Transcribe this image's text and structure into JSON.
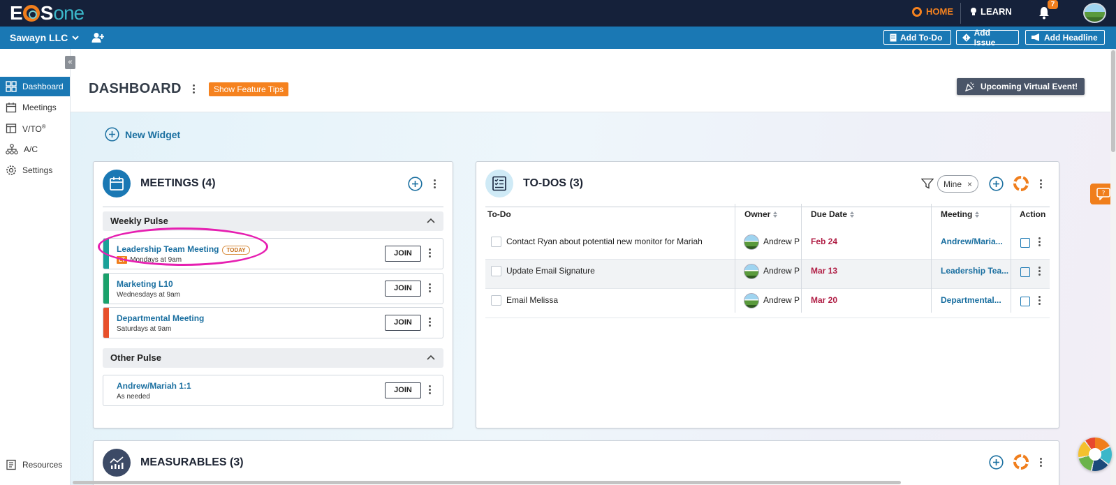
{
  "brand": {
    "logo_text_a": "E",
    "logo_text_s": "S",
    "logo_text_one": "one"
  },
  "topnav": {
    "home": "HOME",
    "learn": "LEARN",
    "notifications_count": "7"
  },
  "companybar": {
    "company": "Sawayn LLC",
    "add_todo": "Add To-Do",
    "add_issue": "Add Issue",
    "add_headline": "Add Headline"
  },
  "sidebar": {
    "items": [
      {
        "label": "Dashboard",
        "active": true
      },
      {
        "label": "Meetings"
      },
      {
        "label": "V/TO",
        "sup": "®"
      },
      {
        "label": "A/C"
      },
      {
        "label": "Settings"
      }
    ],
    "resources": "Resources"
  },
  "dashboard": {
    "title": "DASHBOARD",
    "feature_tips": "Show Feature Tips",
    "virtual_event": "Upcoming Virtual Event!",
    "new_widget": "New Widget"
  },
  "meetings": {
    "title": "MEETINGS (4)",
    "groups": [
      {
        "label": "Weekly Pulse"
      },
      {
        "label": "Other Pulse"
      }
    ],
    "items": [
      {
        "name": "Leadership Team Meeting",
        "badge": "TODAY",
        "tag": "LT",
        "time": "Mondays at 9am",
        "color": "#1aa199",
        "join": "JOIN"
      },
      {
        "name": "Marketing L10",
        "time": "Wednesdays at 9am",
        "color": "#1aa16b",
        "join": "JOIN"
      },
      {
        "name": "Departmental Meeting",
        "time": "Saturdays at 9am",
        "color": "#e8502b",
        "join": "JOIN"
      },
      {
        "name": "Andrew/Mariah 1:1",
        "time": "As needed",
        "color": "#ffffff",
        "join": "JOIN"
      }
    ]
  },
  "todos": {
    "title": "TO-DOS (3)",
    "filter_chip": "Mine",
    "columns": [
      "To-Do",
      "Owner",
      "Due Date",
      "Meeting",
      "Action"
    ],
    "rows": [
      {
        "todo": "Contact Ryan about potential new monitor for Mariah",
        "owner": "Andrew P",
        "due": "Feb 24",
        "meeting": "Andrew/Maria..."
      },
      {
        "todo": "Update Email Signature",
        "owner": "Andrew P",
        "due": "Mar 13",
        "meeting": "Leadership Tea..."
      },
      {
        "todo": "Email Melissa",
        "owner": "Andrew P",
        "due": "Mar 20",
        "meeting": "Departmental..."
      }
    ]
  },
  "measurables": {
    "title": "MEASURABLES (3)"
  },
  "colors": {
    "navy": "#15213a",
    "blue": "#1a78b4",
    "orange": "#f07e1c",
    "highlight": "#e61fb1"
  }
}
